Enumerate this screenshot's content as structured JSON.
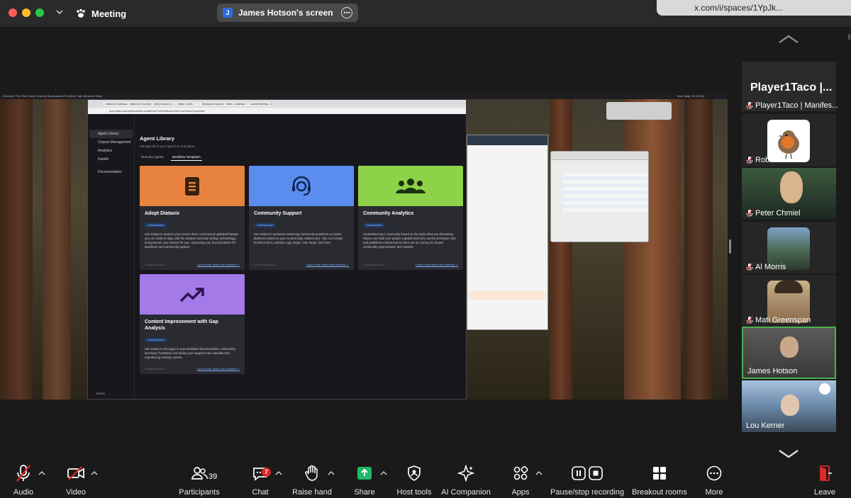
{
  "window": {
    "meeting_title": "Meeting",
    "share_title": "James Hotson's screen",
    "share_avatar_initial": "J",
    "url_popup": "x.com/i/spaces/1YpJk..."
  },
  "shared_screen": {
    "mac_menubar": "Chrome   File   Edit   View   History   Bookmarks   Profiles   Tab   Window   Help",
    "mac_clock": "Mon May 19  09:36",
    "browser_tabs": [
      "Katara AI Dashboard | Ag",
      "Katara AI Overview DAVA",
      "(163) Discord | #... gene",
      "News | DAVA",
      "Wordpress Dashboard",
      "Notes - Calendar - Meet",
      "Launch Meeting - Zoom"
    ],
    "address": "app.katara.ai/dashboard/ai-workflows/7aWorkflowsView=workflowTemplates",
    "sidebar": [
      "Agent Library",
      "Corpus Management",
      "Analytics",
      "DaniAI",
      "Documentation"
    ],
    "sidebar_bottom": "Demo",
    "page_title": "Agent Library",
    "page_subtitle": "Manage all of your agents in one place.",
    "tabs": [
      "Running Agents",
      "Workflow Templates"
    ],
    "cards": [
      {
        "title": "Adopt Diataxis",
        "badge": "Coming soon!",
        "color": "#e8833f",
        "desc": "Use Katara to analyze your current docs, recommend updates/changes you can make to align with the Diataxis technical writing methodology, and generate new content for you - improving your documentation for developer and community support.",
        "create": "Create workflow →",
        "learn": "Learn more about this workflow ↗"
      },
      {
        "title": "Community Support",
        "badge": "Coming soon!",
        "color": "#5b8def",
        "desc": "Use Katara to automate answering community questions on native platforms based on your curated data collection(s) - this can include technical docs, website copy, blogs, code repos, and more.",
        "create": "Create workflow →",
        "learn": "Learn more about this workflow ↗"
      },
      {
        "title": "Community Analytics",
        "badge": "Coming soon!",
        "color": "#8ed24a",
        "desc": "Understand your community based on the topics they are discussing - Katara can build your project a global taxonomy across developer chat and published content that we then use as a proxy for deeper community segmentation and insights.",
        "create": "Create workflow →",
        "learn": "Learn more about this workflow ↗"
      },
      {
        "title": "Content Improvement with Gap Analysis",
        "badge": "Coming soon!",
        "color": "#a479e8",
        "desc": "Use Katara to find gaps in your published documentation, eliminating developer frustration and saving your support team valuable time reproducing missing content.",
        "create": "Create workflow →",
        "learn": "Learn more about this workflow ↗"
      }
    ]
  },
  "gallery": {
    "header_title": "Player1Taco |...",
    "participants": [
      {
        "name": "Player1Taco | Manifes...",
        "muted": true
      },
      {
        "name": "Robin",
        "muted": true
      },
      {
        "name": "Peter Chmiel",
        "muted": true
      },
      {
        "name": "Al Morris",
        "muted": true
      },
      {
        "name": "Mati Greenspan",
        "muted": true
      },
      {
        "name": "James Hotson",
        "muted": false,
        "speaking": true
      },
      {
        "name": "Lou Kerner",
        "muted": false
      }
    ]
  },
  "toolbar": {
    "audio": "Audio",
    "video": "Video",
    "participants": "Participants",
    "participants_count": "39",
    "chat": "Chat",
    "chat_badge": "7",
    "raise_hand": "Raise hand",
    "share": "Share",
    "host_tools": "Host tools",
    "ai_companion": "AI Companion",
    "apps": "Apps",
    "record": "Pause/stop recording",
    "breakout": "Breakout rooms",
    "more": "More",
    "leave": "Leave"
  },
  "colors": {
    "share_green": "#1fb86a",
    "mute_red": "#e02828",
    "speaking_border": "#4caf50"
  }
}
